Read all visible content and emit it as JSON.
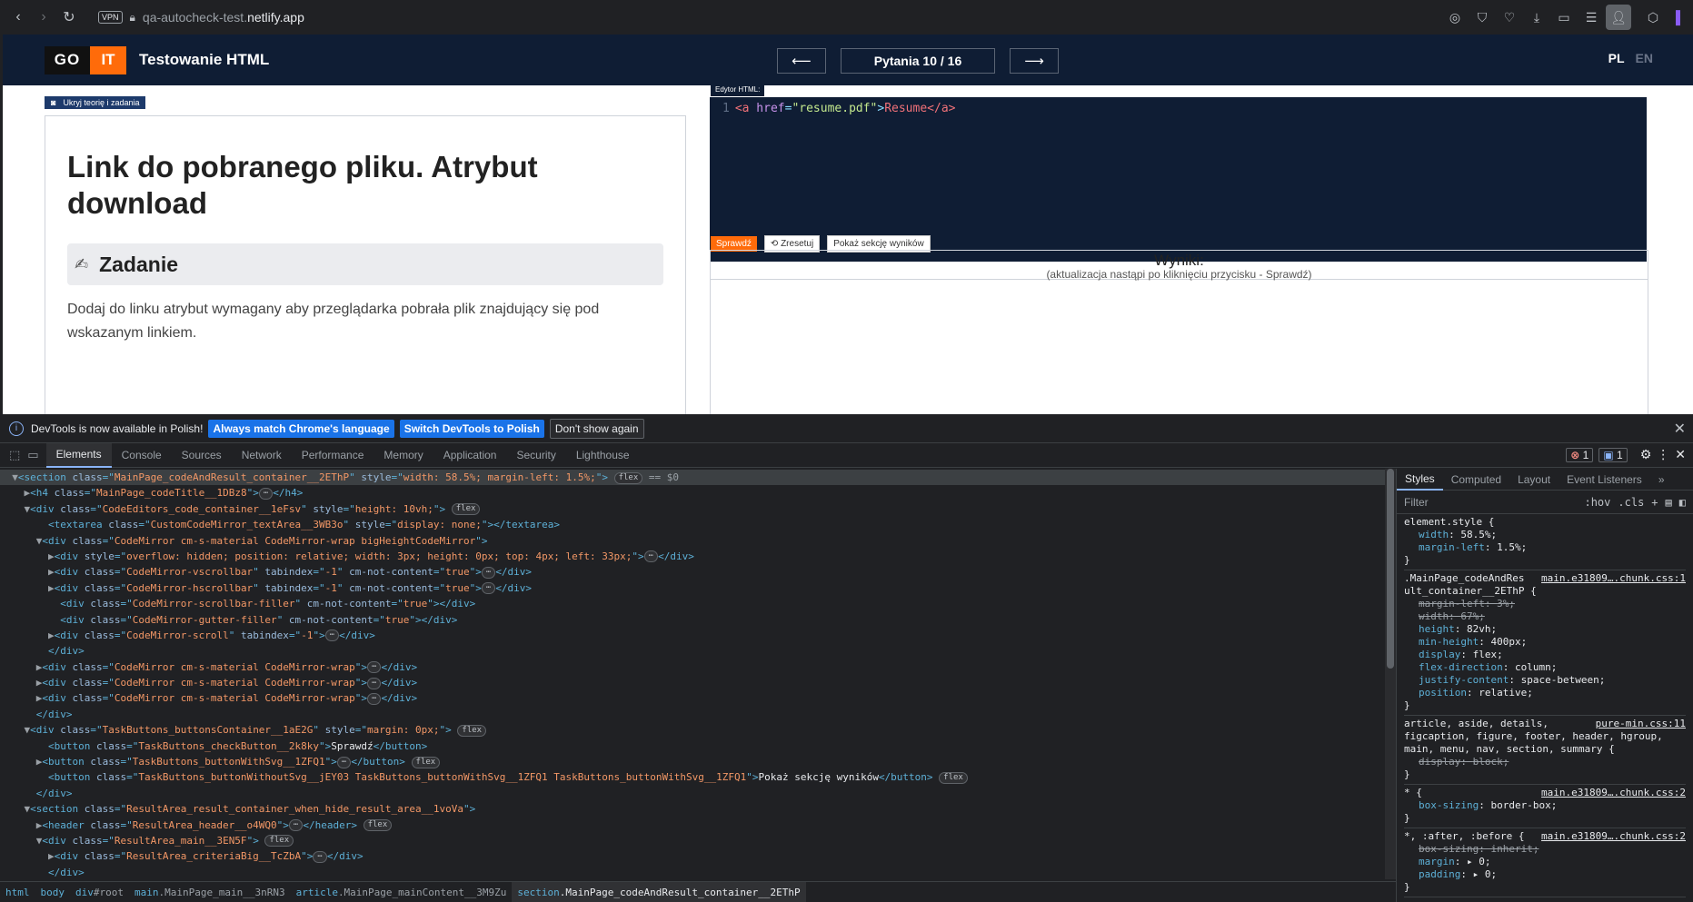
{
  "browser": {
    "url_prefix": "qa-autocheck-test.",
    "url_domain": "netlify.app",
    "vpn_label": "VPN",
    "icons": [
      "back-icon",
      "forward-icon",
      "reload-icon"
    ]
  },
  "app": {
    "logo_go": "GO",
    "logo_it": "IT",
    "title": "Testowanie HTML",
    "prev_arrow": "⟵",
    "question_counter": "Pytania 10 / 16",
    "next_arrow": "⟶",
    "lang_pl": "PL",
    "lang_en": "EN",
    "accent_color": "#ff6b0a",
    "header_color": "#0f1d34"
  },
  "left": {
    "hide_button": "Ukryj teorię i zadania",
    "lesson_title": "Link do pobranego pliku. Atrybut download",
    "task_title": "Zadanie",
    "task_text": "Dodaj do linku atrybut wymagany aby przeglądarka pobrała plik znajdujący się pod wskazanym linkiem."
  },
  "editor": {
    "label": "Edytor HTML:",
    "line_number": "1",
    "code": {
      "open_tag": "<a",
      "attr": " href",
      "eq": "=",
      "value": "\"resume.pdf\"",
      "gt": ">",
      "text": "Resume",
      "close_tag": "</a>"
    },
    "check_button": "Sprawdź",
    "reset_button": "Zresetuj",
    "show_results_button": "Pokaż sekcję wyników",
    "results_title": "Wyniki:",
    "results_subtitle": "(aktualizacja nastąpi po kliknięciu przycisku - Sprawdź)"
  },
  "devtools": {
    "info_text": "DevTools is now available in Polish!",
    "info_btn1": "Always match Chrome's language",
    "info_btn2": "Switch DevTools to Polish",
    "info_btn3": "Don't show again",
    "tabs": [
      "Elements",
      "Console",
      "Sources",
      "Network",
      "Performance",
      "Memory",
      "Application",
      "Security",
      "Lighthouse"
    ],
    "error_count": "1",
    "message_count": "1",
    "dom_lines": [
      {
        "indent": "  ",
        "arrow": "▼",
        "open": "<section",
        "attrs": [
          [
            "class",
            "MainPage_codeAndResult_container__2EThP"
          ],
          [
            "style",
            "width: 58.5%; margin-left: 1.5%;"
          ]
        ],
        "close": ">",
        "pill": "flex",
        "extra": " == $0",
        "selected": true
      },
      {
        "indent": "    ",
        "arrow": "▶",
        "open": "<h4",
        "attrs": [
          [
            "class",
            "MainPage_codeTitle__1DBz8"
          ]
        ],
        "close": ">",
        "ellipsis": true,
        "end": "</h4>"
      },
      {
        "indent": "    ",
        "arrow": "▼",
        "open": "<div",
        "attrs": [
          [
            "class",
            "CodeEditors_code_container__1eFsv"
          ],
          [
            "style",
            "height: 10vh;"
          ]
        ],
        "close": ">",
        "pill": "flex"
      },
      {
        "indent": "       ",
        "arrow": "",
        "open": "<textarea",
        "attrs": [
          [
            "class",
            "CustomCodeMirror_textArea__3WB3o"
          ],
          [
            "style",
            "display: none;"
          ]
        ],
        "close": ">",
        "end": "</textarea>"
      },
      {
        "indent": "      ",
        "arrow": "▼",
        "open": "<div",
        "attrs": [
          [
            "class",
            "CodeMirror cm-s-material CodeMirror-wrap bigHeightCodeMirror"
          ]
        ],
        "close": ">"
      },
      {
        "indent": "        ",
        "arrow": "▶",
        "open": "<div",
        "attrs": [
          [
            "style",
            "overflow: hidden; position: relative; width: 3px; height: 0px; top: 4px; left: 33px;"
          ]
        ],
        "close": ">",
        "ellipsis": true,
        "end": "</div>"
      },
      {
        "indent": "        ",
        "arrow": "▶",
        "open": "<div",
        "attrs": [
          [
            "class",
            "CodeMirror-vscrollbar"
          ],
          [
            "tabindex",
            "-1"
          ],
          [
            "cm-not-content",
            "true"
          ]
        ],
        "close": ">",
        "ellipsis": true,
        "end": "</div>"
      },
      {
        "indent": "        ",
        "arrow": "▶",
        "open": "<div",
        "attrs": [
          [
            "class",
            "CodeMirror-hscrollbar"
          ],
          [
            "tabindex",
            "-1"
          ],
          [
            "cm-not-content",
            "true"
          ]
        ],
        "close": ">",
        "ellipsis": true,
        "end": "</div>"
      },
      {
        "indent": "         ",
        "arrow": "",
        "open": "<div",
        "attrs": [
          [
            "class",
            "CodeMirror-scrollbar-filler"
          ],
          [
            "cm-not-content",
            "true"
          ]
        ],
        "close": ">",
        "end": "</div>"
      },
      {
        "indent": "         ",
        "arrow": "",
        "open": "<div",
        "attrs": [
          [
            "class",
            "CodeMirror-gutter-filler"
          ],
          [
            "cm-not-content",
            "true"
          ]
        ],
        "close": ">",
        "end": "</div>"
      },
      {
        "indent": "        ",
        "arrow": "▶",
        "open": "<div",
        "attrs": [
          [
            "class",
            "CodeMirror-scroll"
          ],
          [
            "tabindex",
            "-1"
          ]
        ],
        "close": ">",
        "ellipsis": true,
        "end": "</div>"
      },
      {
        "indent": "       ",
        "arrow": "",
        "open": "</div>",
        "attrs": [],
        "close": ""
      },
      {
        "indent": "      ",
        "arrow": "▶",
        "open": "<div",
        "attrs": [
          [
            "class",
            "CodeMirror cm-s-material CodeMirror-wrap"
          ]
        ],
        "close": ">",
        "ellipsis": true,
        "end": "</div>"
      },
      {
        "indent": "      ",
        "arrow": "▶",
        "open": "<div",
        "attrs": [
          [
            "class",
            "CodeMirror cm-s-material CodeMirror-wrap"
          ]
        ],
        "close": ">",
        "ellipsis": true,
        "end": "</div>"
      },
      {
        "indent": "      ",
        "arrow": "▶",
        "open": "<div",
        "attrs": [
          [
            "class",
            "CodeMirror cm-s-material CodeMirror-wrap"
          ]
        ],
        "close": ">",
        "ellipsis": true,
        "end": "</div>"
      },
      {
        "indent": "     ",
        "arrow": "",
        "open": "</div>",
        "attrs": [],
        "close": ""
      },
      {
        "indent": "    ",
        "arrow": "▼",
        "open": "<div",
        "attrs": [
          [
            "class",
            "TaskButtons_buttonsContainer__1aE2G"
          ],
          [
            "style",
            "margin: 0px;"
          ]
        ],
        "close": ">",
        "pill": "flex"
      },
      {
        "indent": "       ",
        "arrow": "",
        "open": "<button",
        "attrs": [
          [
            "class",
            "TaskButtons_checkButton__2k8ky"
          ]
        ],
        "close": ">",
        "text": "Sprawdź",
        "end": "</button>"
      },
      {
        "indent": "      ",
        "arrow": "▶",
        "open": "<button",
        "attrs": [
          [
            "class",
            "TaskButtons_buttonWithSvg__1ZFQ1"
          ]
        ],
        "close": ">",
        "ellipsis": true,
        "end": "</button>",
        "pill": "flex"
      },
      {
        "indent": "       ",
        "arrow": "",
        "open": "<button",
        "attrs": [
          [
            "class",
            "TaskButtons_buttonWithoutSvg__jEY03 TaskButtons_buttonWithSvg__1ZFQ1 TaskButtons_buttonWithSvg__1ZFQ1"
          ]
        ],
        "close": ">",
        "text": "Pokaż sekcję wyników",
        "end": "</button>",
        "pill": "flex"
      },
      {
        "indent": "     ",
        "arrow": "",
        "open": "</div>",
        "attrs": [],
        "close": ""
      },
      {
        "indent": "    ",
        "arrow": "▼",
        "open": "<section",
        "attrs": [
          [
            "class",
            "ResultArea_result_container_when_hide_result_area__1voVa"
          ]
        ],
        "close": ">"
      },
      {
        "indent": "      ",
        "arrow": "▶",
        "open": "<header",
        "attrs": [
          [
            "class",
            "ResultArea_header__o4WQ0"
          ]
        ],
        "close": ">",
        "ellipsis": true,
        "end": "</header>",
        "pill": "flex"
      },
      {
        "indent": "      ",
        "arrow": "▼",
        "open": "<div",
        "attrs": [
          [
            "class",
            "ResultArea_main__3EN5F"
          ]
        ],
        "close": ">",
        "pill": "flex"
      },
      {
        "indent": "        ",
        "arrow": "▶",
        "open": "<div",
        "attrs": [
          [
            "class",
            "ResultArea_criteriaBig__TcZbA"
          ]
        ],
        "close": ">",
        "ellipsis": true,
        "end": "</div>"
      },
      {
        "indent": "       ",
        "arrow": "",
        "open": "</div>",
        "attrs": [],
        "close": ""
      }
    ],
    "style_tabs": [
      "Styles",
      "Computed",
      "Layout",
      "Event Listeners"
    ],
    "filter_placeholder": "Filter",
    "filter_hov": ":hov",
    "filter_cls": ".cls",
    "rules": [
      {
        "selector": "element.style {",
        "source": "",
        "decls": [
          [
            "width",
            "58.5%",
            false
          ],
          [
            "margin-left",
            "1.5%",
            false
          ]
        ]
      },
      {
        "selector": ".MainPage_codeAndRes\nult_container__2EThP {",
        "source": "main.e31809….chunk.css:1",
        "decls": [
          [
            "margin-left",
            "3%",
            true
          ],
          [
            "width",
            "67%",
            true
          ],
          [
            "height",
            "82vh",
            false
          ],
          [
            "min-height",
            "400px",
            false
          ],
          [
            "display",
            "flex",
            false
          ],
          [
            "flex-direction",
            "column",
            false
          ],
          [
            "justify-content",
            "space-between",
            false
          ],
          [
            "position",
            "relative",
            false
          ]
        ]
      },
      {
        "selector": "article, aside, details,\nfigcaption, figure, footer, header, hgroup,\nmain, menu, nav, section, summary {",
        "source": "pure-min.css:11",
        "decls": [
          [
            "display",
            "block",
            true
          ]
        ]
      },
      {
        "selector": "* {",
        "source": "main.e31809….chunk.css:2",
        "decls": [
          [
            "box-sizing",
            "border-box",
            false
          ]
        ]
      },
      {
        "selector": "*, :after, :before {",
        "source": "main.e31809….chunk.css:2",
        "decls": [
          [
            "box-sizing",
            "inherit",
            true
          ],
          [
            "margin",
            "▸ 0",
            false
          ],
          [
            "padding",
            "▸ 0",
            false
          ]
        ]
      }
    ],
    "breadcrumbs": [
      [
        "html",
        ""
      ],
      [
        "body",
        ""
      ],
      [
        "div",
        "#root"
      ],
      [
        "main",
        ".MainPage_main__3nRN3"
      ],
      [
        "article",
        ".MainPage_mainContent__3M9Zu"
      ],
      [
        "section",
        ".MainPage_codeAndResult_container__2EThP"
      ]
    ]
  }
}
